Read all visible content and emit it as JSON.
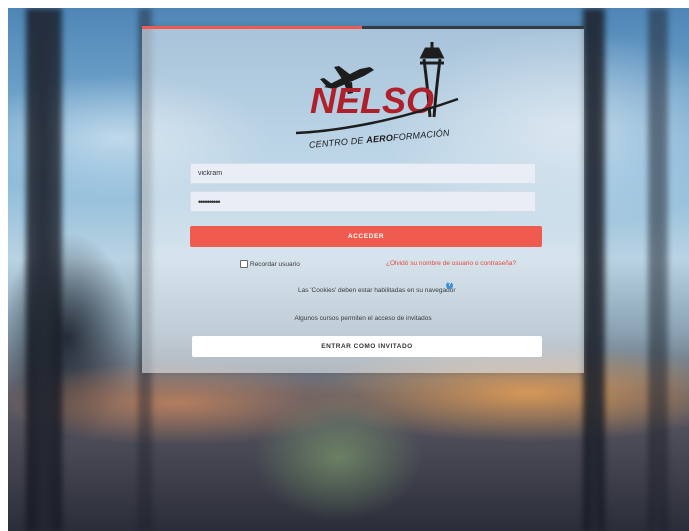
{
  "logo": {
    "brand": "NELSO",
    "subtitle_prefix": "CENTRO DE ",
    "subtitle_bold": "AERO",
    "subtitle_suffix": "FORMACIÓN",
    "brand_color": "#b0202a"
  },
  "login": {
    "username_value": "vickram",
    "password_value": "••••••••••",
    "submit_label": "ACCEDER",
    "remember_label": "Recordar usuario",
    "remember_checked": false,
    "forgot_link": "¿Olvidó su nombre de usuario o contraseña?",
    "cookies_notice": "Las 'Cookies' deben estar habilitadas en su navegador",
    "guests_note": "Algunos cursos permiten el acceso de invitados",
    "guest_button": "ENTRAR COMO INVITADO"
  },
  "colors": {
    "accent": "#ef5b4f",
    "link": "#e4493f",
    "help_icon": "#3f8ed8"
  },
  "icons": {
    "help": "question-circle-icon",
    "plane": "airplane-icon",
    "tower": "control-tower-icon"
  }
}
